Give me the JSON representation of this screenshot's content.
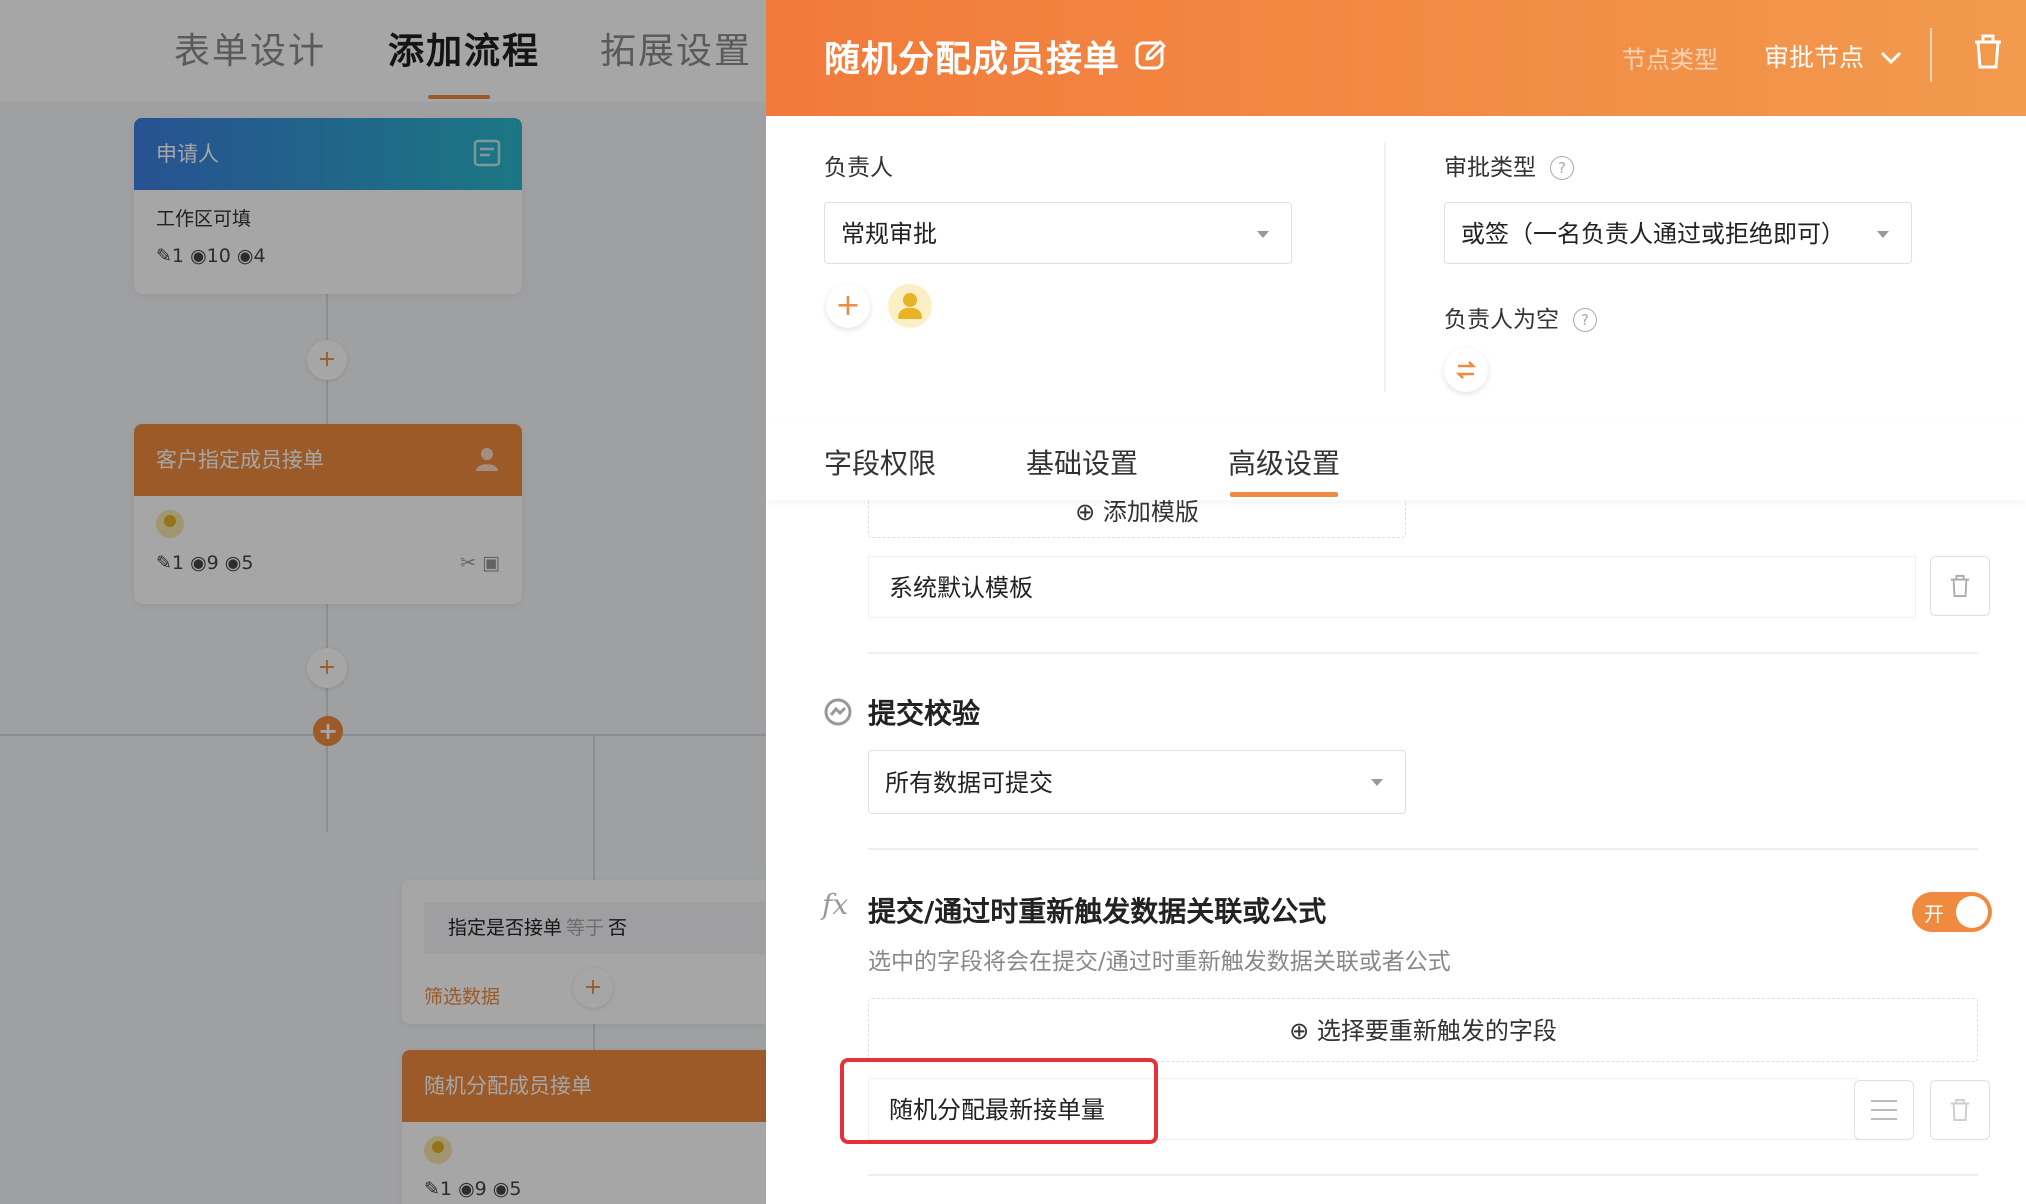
{
  "left": {
    "tabs": [
      "表单设计",
      "添加流程",
      "拓展设置"
    ],
    "applicant_node": {
      "title": "申请人",
      "body": "工作区可填",
      "stats": {
        "edit": "1",
        "view": "10",
        "hidden": "4"
      }
    },
    "customer_node": {
      "title": "客户指定成员接单",
      "stats": {
        "edit": "1",
        "view": "9",
        "hidden": "5"
      }
    },
    "condition": {
      "field": "指定是否接单",
      "op": "等于",
      "value": "否",
      "link": "筛选数据"
    },
    "random_node": {
      "title": "随机分配成员接单",
      "stats": {
        "edit": "1",
        "view": "9",
        "hidden": "5"
      }
    }
  },
  "drawer": {
    "title": "随机分配成员接单",
    "node_type_label": "节点类型",
    "node_type_value": "审批节点",
    "assignee": {
      "label": "负责人",
      "value": "常规审批"
    },
    "approval_type": {
      "label": "审批类型",
      "value": "或签（一名负责人通过或拒绝即可）"
    },
    "empty_assignee": {
      "label": "负责人为空"
    },
    "tabs": [
      "字段权限",
      "基础设置",
      "高级设置"
    ],
    "template": {
      "add_label": "添加模版",
      "default_name": "系统默认模板"
    },
    "submit_check": {
      "title": "提交校验",
      "value": "所有数据可提交"
    },
    "retrigger": {
      "title": "提交/通过时重新触发数据关联或公式",
      "toggle_label": "开",
      "toggle_on": true,
      "description": "选中的字段将会在提交/通过时重新触发数据关联或者公式",
      "add_label": "选择要重新触发的字段",
      "fields": [
        "随机分配最新接单量"
      ]
    }
  },
  "colors": {
    "accent": "#f08a3e",
    "header_start": "#f27a3a",
    "header_end": "#f29a4e",
    "highlight": "#e5323a"
  }
}
